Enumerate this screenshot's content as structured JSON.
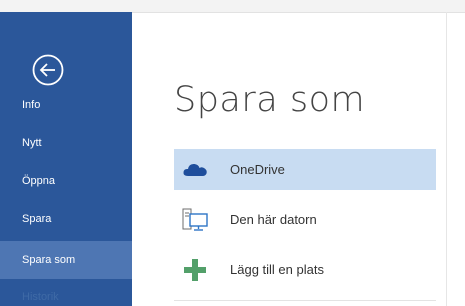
{
  "sidebar": {
    "back_icon": "back-arrow-icon",
    "items": [
      {
        "label": "Info",
        "selected": false
      },
      {
        "label": "Nytt",
        "selected": false
      },
      {
        "label": "Öppna",
        "selected": false
      },
      {
        "label": "Spara",
        "selected": false
      },
      {
        "label": "Spara som",
        "selected": true
      },
      {
        "label": "Historik",
        "selected": false
      }
    ],
    "color": "#2b579a",
    "selected_color": "#4e76b3"
  },
  "main": {
    "title": "Spara som",
    "locations": [
      {
        "label": "OneDrive",
        "icon": "cloud-icon",
        "selected": true
      },
      {
        "label": "Den här datorn",
        "icon": "computer-icon",
        "selected": false
      },
      {
        "label": "Lägg till en plats",
        "icon": "plus-icon",
        "selected": false
      }
    ],
    "selected_color": "#c8dcf2"
  }
}
